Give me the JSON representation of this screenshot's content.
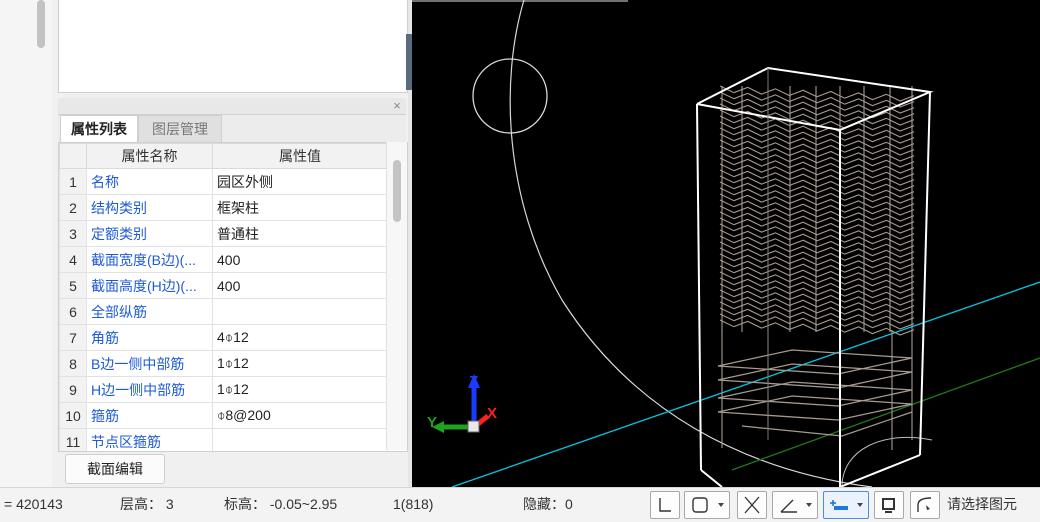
{
  "panel": {
    "tabs": [
      "属性列表",
      "图层管理"
    ],
    "close_glyph": "×",
    "headers": {
      "index": "",
      "name": "属性名称",
      "value": "属性值"
    },
    "rows": [
      {
        "index": "1",
        "name": "名称",
        "value": "园区外侧"
      },
      {
        "index": "2",
        "name": "结构类别",
        "value": "框架柱"
      },
      {
        "index": "3",
        "name": "定额类别",
        "value": "普通柱"
      },
      {
        "index": "4",
        "name": "截面宽度(B边)(...",
        "value": "400"
      },
      {
        "index": "5",
        "name": "截面高度(H边)(...",
        "value": "400"
      },
      {
        "index": "6",
        "name": "全部纵筋",
        "value": ""
      },
      {
        "index": "7",
        "name": "角筋",
        "value": "4⌽12"
      },
      {
        "index": "8",
        "name": "B边一侧中部筋",
        "value": "1⌽12"
      },
      {
        "index": "9",
        "name": "H边一侧中部筋",
        "value": "1⌽12"
      },
      {
        "index": "10",
        "name": "箍筋",
        "value": "⌽8@200"
      },
      {
        "index": "11",
        "name": "节点区箍筋",
        "value": ""
      }
    ],
    "edit_button": "截面编辑"
  },
  "viewport": {
    "axis_labels": {
      "x": "X",
      "y": "Y",
      "z": "Z"
    },
    "colors": {
      "background": "#000000",
      "cage": "#a89a8f",
      "box": "#ffffff",
      "cyan_line": "#00c8e6",
      "green_line": "#1f7a1f"
    }
  },
  "statusbar": {
    "coord": "= 420143",
    "floor_height": "层高： 3",
    "elevation": "标高： -0.05~2.95",
    "count": "1(818)",
    "hidden": "隐藏：0",
    "prompt": "请选择图元",
    "tools": [
      "orthogonal-icon",
      "object-snap-icon",
      "disable-snap-icon",
      "angle-icon",
      "add-point-icon",
      "display-icon",
      "arc-icon"
    ]
  }
}
